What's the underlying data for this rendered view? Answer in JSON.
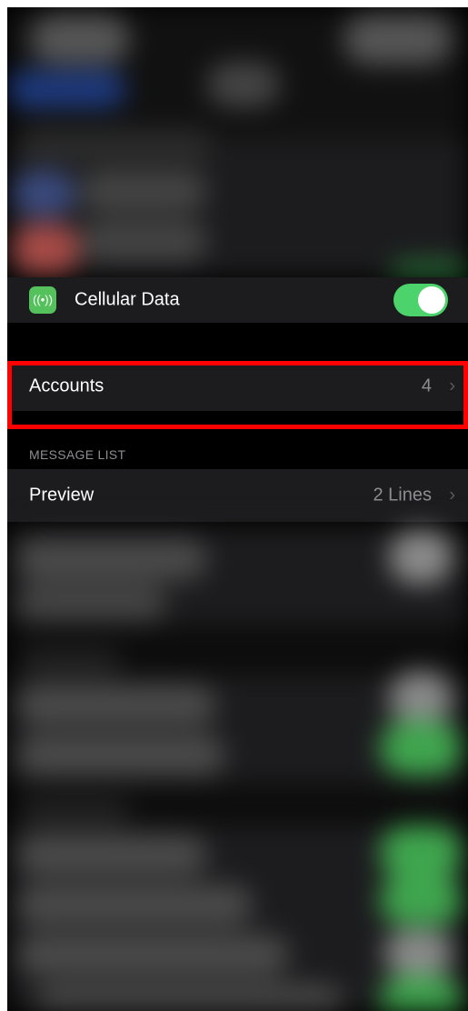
{
  "mail_settings": {
    "cellular": {
      "label": "Cellular Data",
      "enabled": true,
      "icon": "antenna-icon",
      "icon_color": "#54c15c",
      "toggle_color": "#4cd36b"
    },
    "accounts": {
      "label": "Accounts",
      "value": "4"
    },
    "message_list": {
      "header": "MESSAGE LIST",
      "preview": {
        "label": "Preview",
        "value": "2 Lines"
      }
    }
  },
  "highlight_color": "#ff0000"
}
